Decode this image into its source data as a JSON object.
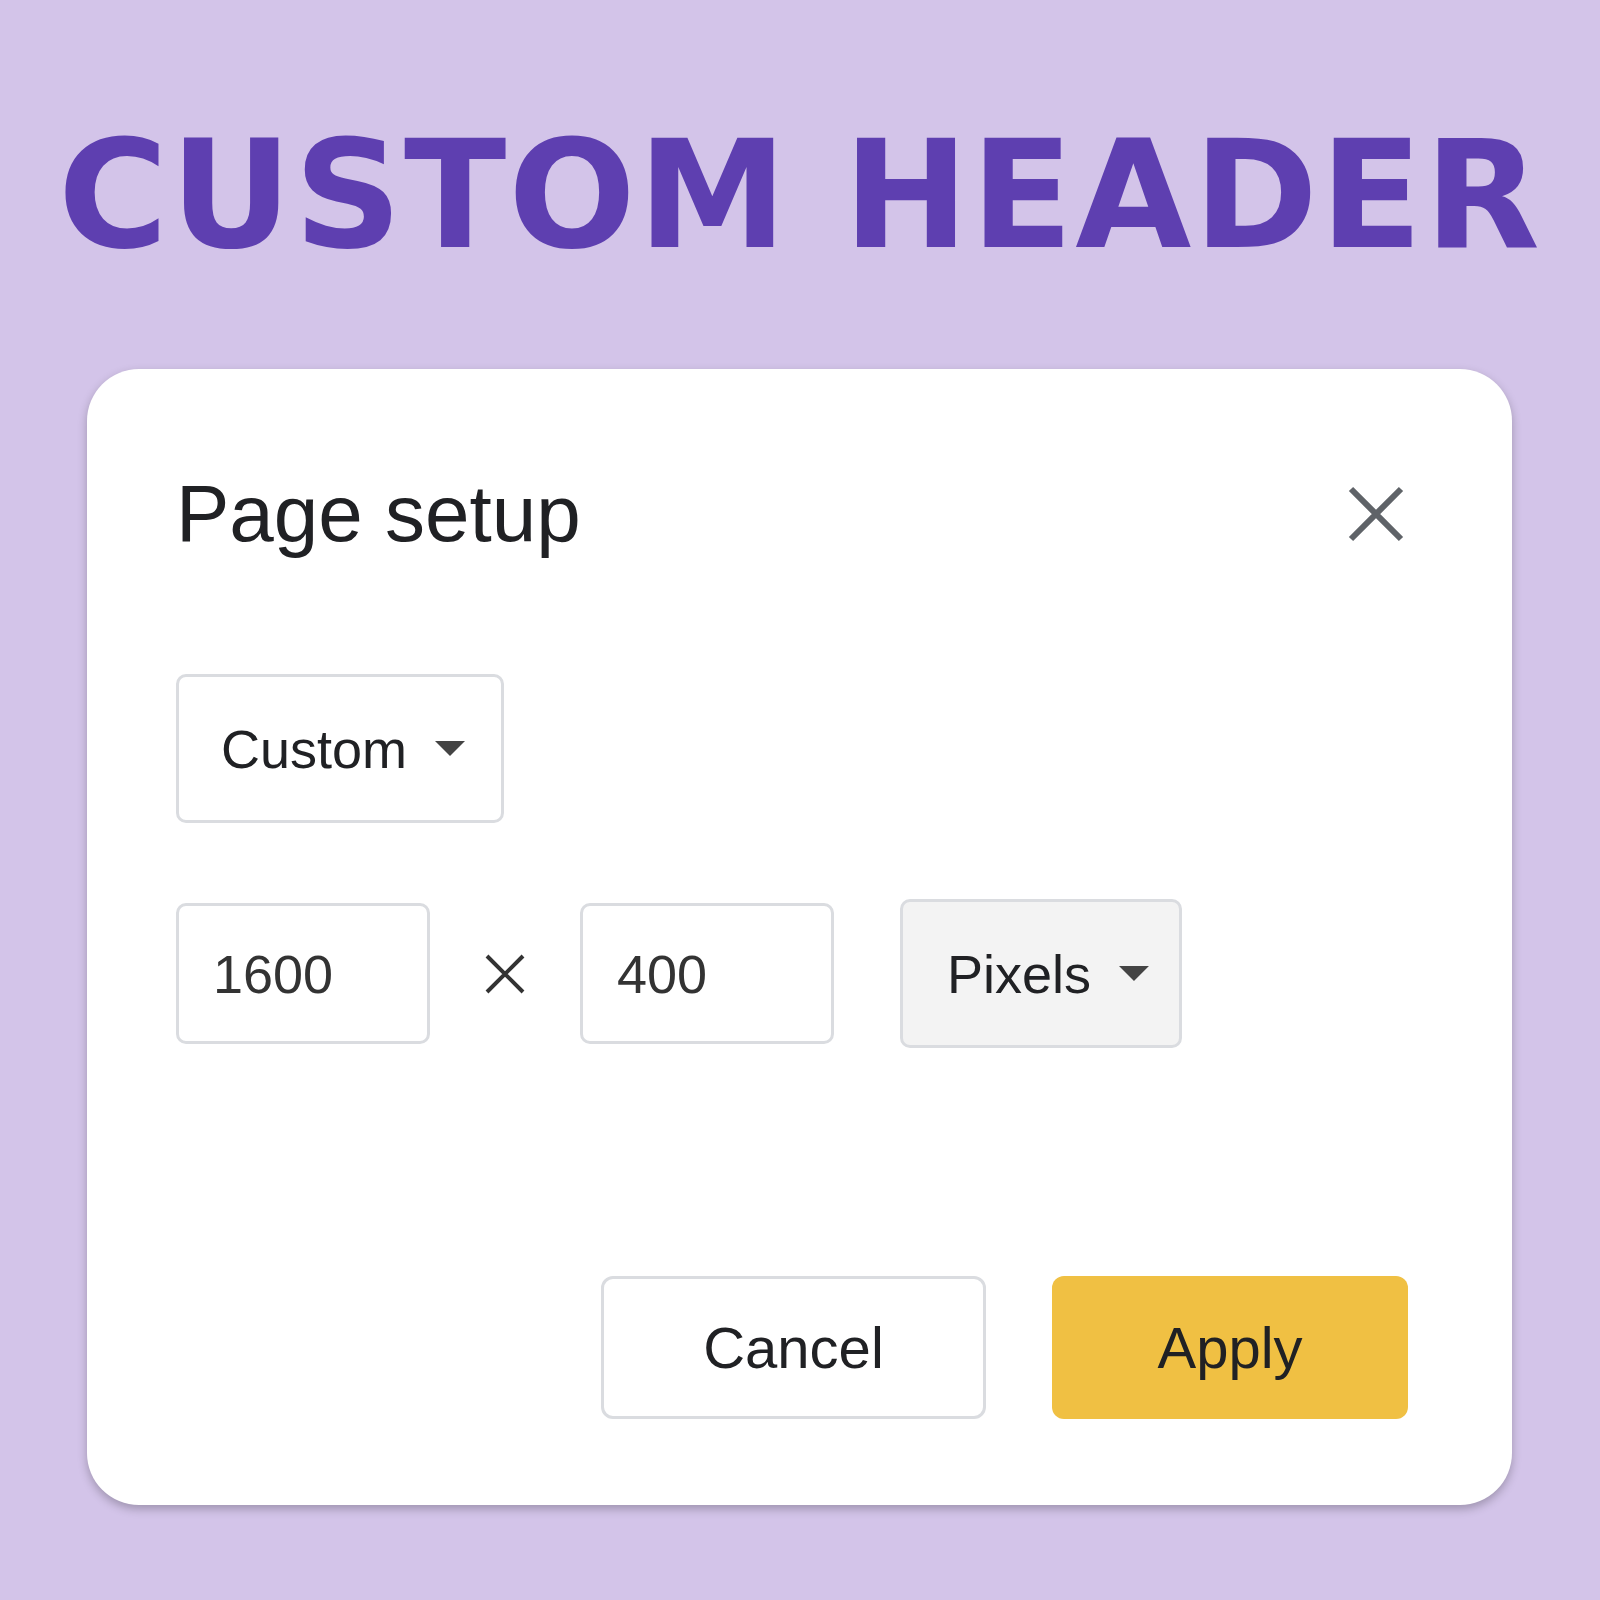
{
  "header": {
    "title": "CUSTOM HEADER"
  },
  "dialog": {
    "title": "Page setup",
    "preset": {
      "value": "Custom"
    },
    "width": {
      "value": "1600"
    },
    "height": {
      "value": "400"
    },
    "unit": {
      "value": "Pixels"
    },
    "buttons": [
      {
        "label": "Cancel",
        "kind": "secondary"
      },
      {
        "label": "Apply",
        "kind": "primary"
      }
    ]
  }
}
